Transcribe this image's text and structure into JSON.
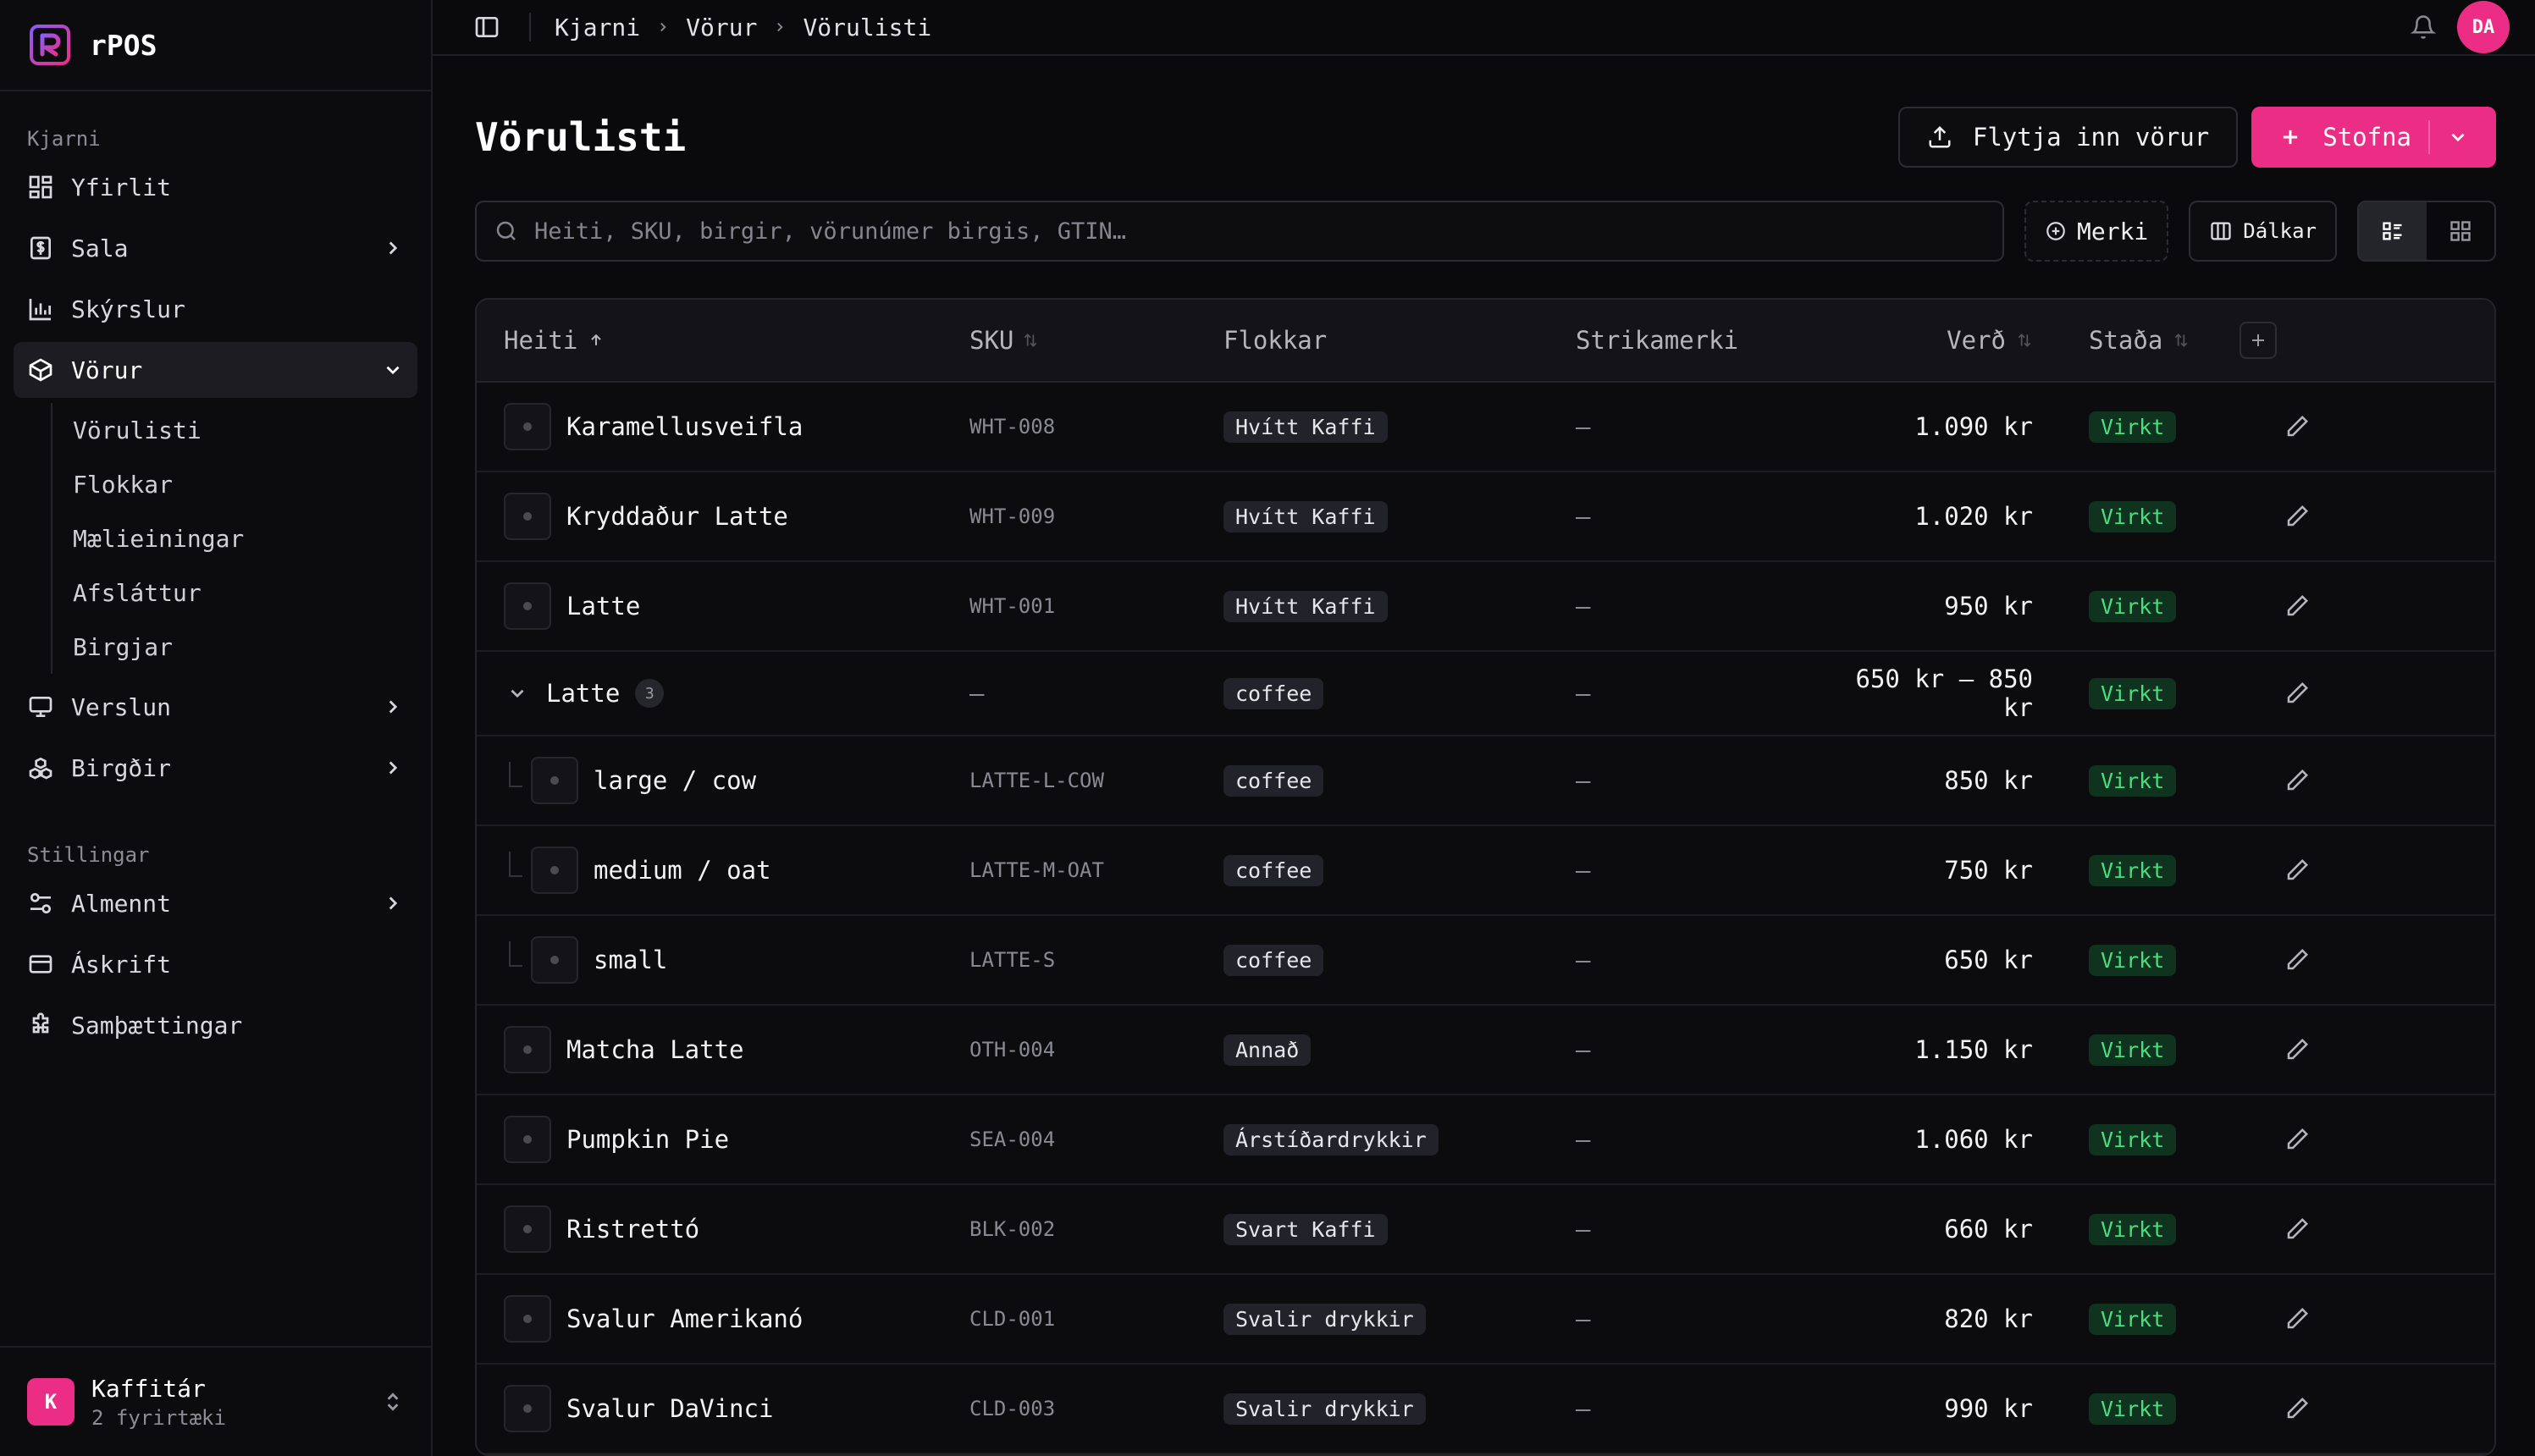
{
  "app": {
    "name": "rPOS"
  },
  "sidebar": {
    "section_core": "Kjarni",
    "items": [
      {
        "label": "Yfirlit",
        "icon": "dashboard-icon"
      },
      {
        "label": "Sala",
        "icon": "receipt-icon"
      },
      {
        "label": "Skýrslur",
        "icon": "bar-chart-icon"
      },
      {
        "label": "Vörur",
        "icon": "package-icon"
      },
      {
        "label": "Verslun",
        "icon": "monitor-icon"
      },
      {
        "label": "Birgðir",
        "icon": "boxes-icon"
      }
    ],
    "products_sub": [
      "Vörulisti",
      "Flokkar",
      "Mælieiningar",
      "Afsláttur",
      "Birgjar"
    ],
    "section_settings": "Stillingar",
    "settings_items": [
      {
        "label": "Almennt",
        "icon": "sliders-icon"
      },
      {
        "label": "Áskrift",
        "icon": "credit-card-icon"
      },
      {
        "label": "Samþættingar",
        "icon": "puzzle-icon"
      }
    ],
    "org": {
      "initial": "K",
      "name": "Kaffitár",
      "sub": "2 fyrirtæki"
    }
  },
  "topbar": {
    "breadcrumb": [
      "Kjarni",
      "Vörur",
      "Vörulisti"
    ],
    "user_initials": "DA"
  },
  "page": {
    "title": "Vörulisti",
    "import_label": "Flytja inn vörur",
    "create_label": "Stofna",
    "search_placeholder": "Heiti, SKU, birgir, vörunúmer birgis, GTIN…",
    "tags_label": "Merki",
    "columns_label": "Dálkar"
  },
  "table": {
    "headers": {
      "name": "Heiti",
      "sku": "SKU",
      "categories": "Flokkar",
      "barcode": "Strikamerki",
      "price": "Verð",
      "status": "Staða"
    },
    "rows": [
      {
        "type": "item",
        "name": "Karamellusveifla",
        "sku": "WHT-008",
        "category": "Hvítt Kaffi",
        "barcode": "—",
        "price": "1.090 kr",
        "status": "Virkt"
      },
      {
        "type": "item",
        "name": "Kryddaður Latte",
        "sku": "WHT-009",
        "category": "Hvítt Kaffi",
        "barcode": "—",
        "price": "1.020 kr",
        "status": "Virkt"
      },
      {
        "type": "item",
        "name": "Latte",
        "sku": "WHT-001",
        "category": "Hvítt Kaffi",
        "barcode": "—",
        "price": "950 kr",
        "status": "Virkt"
      },
      {
        "type": "group",
        "name": "Latte",
        "count": "3",
        "sku": "—",
        "category": "coffee",
        "barcode": "—",
        "price": "650 kr – 850 kr",
        "status": "Virkt"
      },
      {
        "type": "child",
        "name": "large / cow",
        "sku": "LATTE-L-COW",
        "category": "coffee",
        "barcode": "—",
        "price": "850 kr",
        "status": "Virkt"
      },
      {
        "type": "child",
        "name": "medium / oat",
        "sku": "LATTE-M-OAT",
        "category": "coffee",
        "barcode": "—",
        "price": "750 kr",
        "status": "Virkt"
      },
      {
        "type": "child",
        "name": "small",
        "sku": "LATTE-S",
        "category": "coffee",
        "barcode": "—",
        "price": "650 kr",
        "status": "Virkt"
      },
      {
        "type": "item",
        "name": "Matcha Latte",
        "sku": "OTH-004",
        "category": "Annað",
        "barcode": "—",
        "price": "1.150 kr",
        "status": "Virkt"
      },
      {
        "type": "item",
        "name": "Pumpkin Pie",
        "sku": "SEA-004",
        "category": "Árstíðardrykkir",
        "barcode": "—",
        "price": "1.060 kr",
        "status": "Virkt"
      },
      {
        "type": "item",
        "name": "Ristrettó",
        "sku": "BLK-002",
        "category": "Svart Kaffi",
        "barcode": "—",
        "price": "660 kr",
        "status": "Virkt"
      },
      {
        "type": "item",
        "name": "Svalur Amerikanó",
        "sku": "CLD-001",
        "category": "Svalir drykkir",
        "barcode": "—",
        "price": "820 kr",
        "status": "Virkt"
      },
      {
        "type": "item",
        "name": "Svalur DaVinci",
        "sku": "CLD-003",
        "category": "Svalir drykkir",
        "barcode": "—",
        "price": "990 kr",
        "status": "Virkt"
      }
    ]
  },
  "colors": {
    "accent": "#ec2d86",
    "status_active_bg": "#10331f",
    "status_active_fg": "#4ade80"
  }
}
